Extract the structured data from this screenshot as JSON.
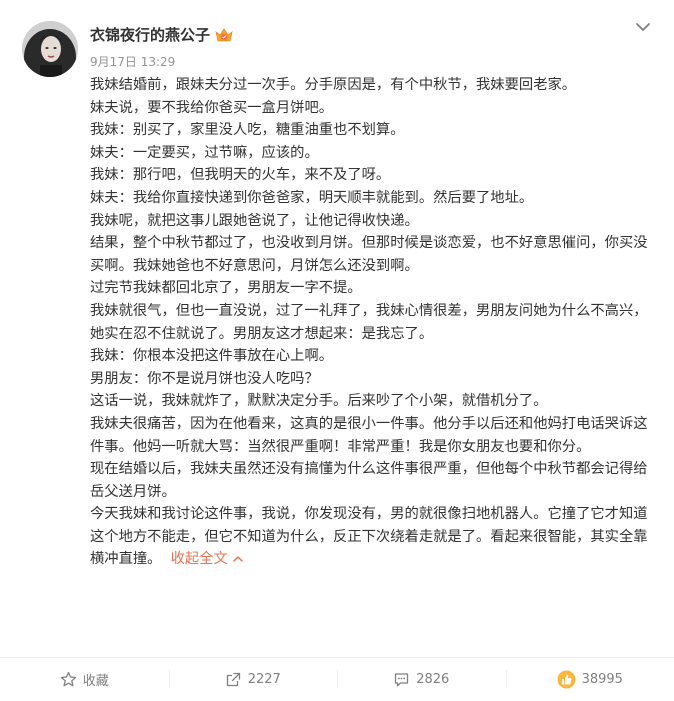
{
  "post": {
    "username": "衣锦夜行的燕公子",
    "timestamp": "9月17日 13:29",
    "paragraphs": [
      "我妹结婚前，跟妹夫分过一次手。分手原因是，有个中秋节，我妹要回老家。",
      "妹夫说，要不我给你爸买一盒月饼吧。",
      "我妹：别买了，家里没人吃，糖重油重也不划算。",
      "妹夫：一定要买，过节嘛，应该的。",
      "我妹：那行吧，但我明天的火车，来不及了呀。",
      "妹夫：我给你直接快递到你爸爸家，明天顺丰就能到。然后要了地址。",
      "我妹呢，就把这事儿跟她爸说了，让他记得收快递。",
      "结果，整个中秋节都过了，也没收到月饼。但那时候是谈恋爱，也不好意思催问，你买没买啊。我妹她爸也不好意思问，月饼怎么还没到啊。",
      "过完节我妹都回北京了，男朋友一字不提。",
      "我妹就很气，但也一直没说，过了一礼拜了，我妹心情很差，男朋友问她为什么不高兴，她实在忍不住就说了。男朋友这才想起来：是我忘了。",
      "我妹：你根本没把这件事放在心上啊。",
      "男朋友：你不是说月饼也没人吃吗？",
      "这话一说，我妹就炸了，默默决定分手。后来吵了个小架，就借机分了。",
      "我妹夫很痛苦，因为在他看来，这真的是很小一件事。他分手以后还和他妈打电话哭诉这件事。他妈一听就大骂：当然很严重啊！非常严重！我是你女朋友也要和你分。",
      "现在结婚以后，我妹夫虽然还没有搞懂为什么这件事很严重，但他每个中秋节都会记得给岳父送月饼。"
    ],
    "last_paragraph": "今天我妹和我讨论这件事，我说，你发现没有，男的就很像扫地机器人。它撞了它才知道这个地方不能走，但它不知道为什么，反正下次绕着走就是了。看起来很智能，其实全靠横冲直撞。",
    "collapse_label": "收起全文"
  },
  "actions": {
    "favorite_label": "收藏",
    "repost_count": "2227",
    "comment_count": "2826",
    "like_count": "38995"
  },
  "icons": {
    "badge": "vip-crown-icon",
    "menu": "chevron-down-icon",
    "favorite": "star-icon",
    "repost": "repost-icon",
    "comment": "comment-icon",
    "like": "thumbs-up-icon"
  },
  "colors": {
    "link": "#eb7350",
    "meta": "#939393",
    "action_text": "#808080",
    "like_icon": "#f5a623"
  }
}
